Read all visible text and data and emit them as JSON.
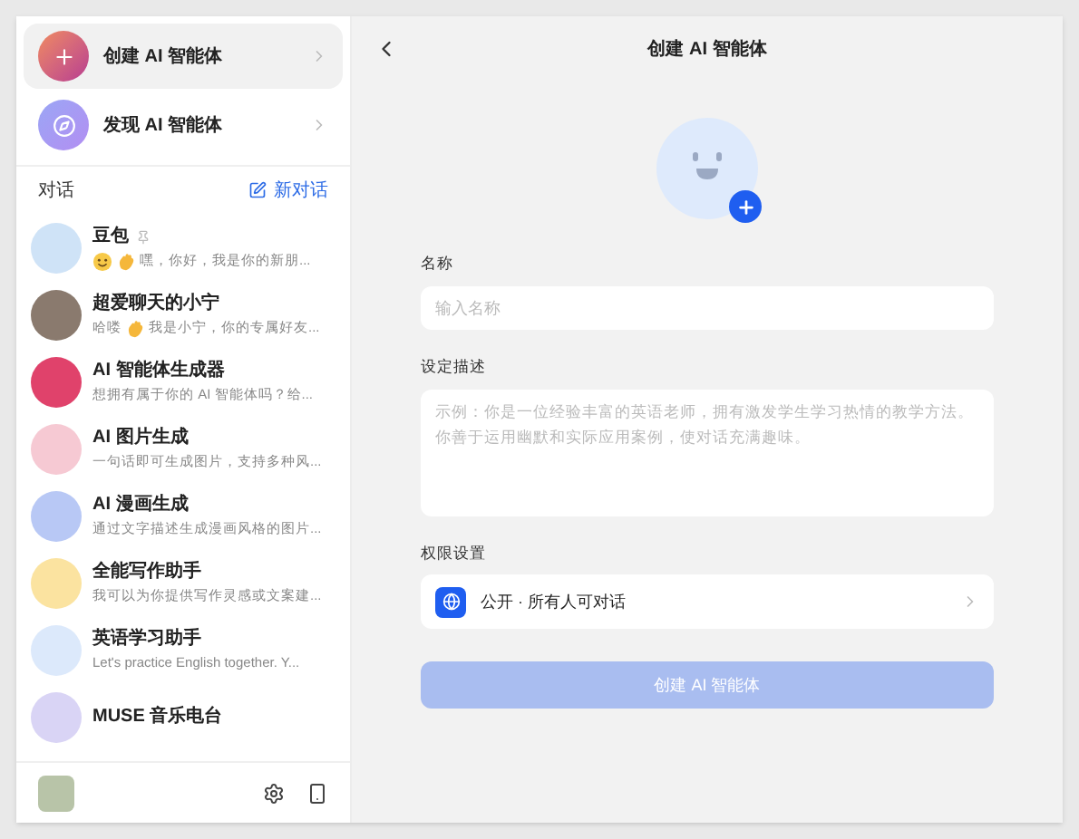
{
  "sidebar": {
    "actions": [
      {
        "label": "创建 AI 智能体",
        "kind": "create",
        "selected": true
      },
      {
        "label": "发现 AI 智能体",
        "kind": "discover",
        "selected": false
      }
    ],
    "section_title": "对话",
    "new_chat": "新对话",
    "chats": [
      {
        "name": "豆包",
        "pinned": true,
        "color": "#cfe3f7",
        "preview": [
          {
            "kind": "smile"
          },
          {
            "kind": "wave"
          },
          {
            "kind": "text",
            "text": "嘿，你好，我是你的新朋..."
          }
        ]
      },
      {
        "name": "超爱聊天的小宁",
        "pinned": false,
        "color": "#8a7a6e",
        "preview": [
          {
            "kind": "text",
            "text": "哈喽"
          },
          {
            "kind": "wave"
          },
          {
            "kind": "text",
            "text": "我是小宁，你的专属好友..."
          }
        ]
      },
      {
        "name": "AI 智能体生成器",
        "pinned": false,
        "color": "#e0426b",
        "preview": [
          {
            "kind": "text",
            "text": "想拥有属于你的 AI 智能体吗？给..."
          }
        ]
      },
      {
        "name": "AI 图片生成",
        "pinned": false,
        "color": "#f6c9d3",
        "preview": [
          {
            "kind": "text",
            "text": "一句话即可生成图片，支持多种风..."
          }
        ]
      },
      {
        "name": "AI 漫画生成",
        "pinned": false,
        "color": "#b8c8f5",
        "preview": [
          {
            "kind": "text",
            "text": "通过文字描述生成漫画风格的图片..."
          }
        ]
      },
      {
        "name": "全能写作助手",
        "pinned": false,
        "color": "#fbe3a0",
        "preview": [
          {
            "kind": "text",
            "text": "我可以为你提供写作灵感或文案建..."
          }
        ]
      },
      {
        "name": "英语学习助手",
        "pinned": false,
        "color": "#dce9fb",
        "preview": [
          {
            "kind": "text",
            "text": "Let's practice English together. Y..."
          }
        ]
      },
      {
        "name": "MUSE 音乐电台",
        "pinned": false,
        "color": "#d9d4f5"
      }
    ]
  },
  "main": {
    "title": "创建 AI 智能体",
    "name_label": "名称",
    "name_placeholder": "输入名称",
    "desc_label": "设定描述",
    "desc_placeholder": "示例：你是一位经验丰富的英语老师，拥有激发学生学习热情的教学方法。你善于运用幽默和实际应用案例，使对话充满趣味。",
    "perm_label": "权限设置",
    "perm_value": "公开 · 所有人可对话",
    "submit": {
      "label": "创建 AI 智能体",
      "disabled": true
    }
  }
}
